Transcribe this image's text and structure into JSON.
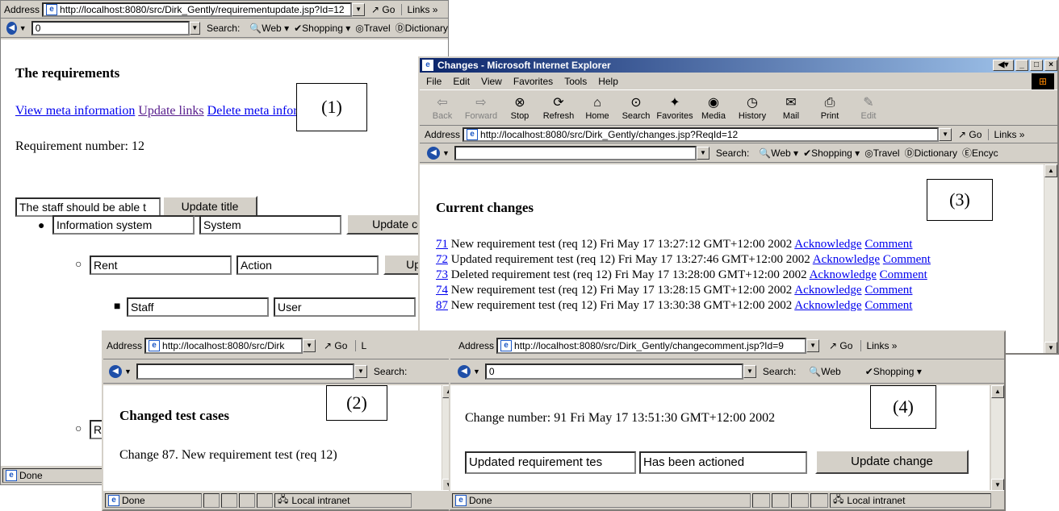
{
  "win1": {
    "address_label": "Address",
    "url": "http://localhost:8080/src/Dirk_Gently/requirementupdate.jsp?Id=12",
    "go": "Go",
    "links": "Links",
    "search_value": "0",
    "search_label": "Search:",
    "search_opts": [
      "Web",
      "Shopping",
      "Travel",
      "Dictionary"
    ],
    "heading": "The requirements",
    "link_view": "View meta information",
    "link_update": "Update links",
    "link_delete": "Delete meta information",
    "req_number": "Requirement number: 12",
    "title_value": "The staff should be able t",
    "update_title": "Update title",
    "rows": [
      {
        "a": "Information system",
        "b": "System",
        "btn": "Update co"
      },
      {
        "a": "Rent",
        "b": "Action",
        "btn": "Upd"
      },
      {
        "a": "Staff",
        "b": "User"
      },
      {
        "a": "R"
      }
    ],
    "status": "Done",
    "callout": "(1)"
  },
  "win3": {
    "title": "Changes - Microsoft Internet Explorer",
    "menu": [
      "File",
      "Edit",
      "View",
      "Favorites",
      "Tools",
      "Help"
    ],
    "tools": [
      "Back",
      "Forward",
      "Stop",
      "Refresh",
      "Home",
      "Search",
      "Favorites",
      "Media",
      "History",
      "Mail",
      "Print",
      "Edit"
    ],
    "address_label": "Address",
    "url": "http://localhost:8080/src/Dirk_Gently/changes.jsp?ReqId=12",
    "go": "Go",
    "links": "Links",
    "search_label": "Search:",
    "search_opts": [
      "Web",
      "Shopping",
      "Travel",
      "Dictionary",
      "Encyc"
    ],
    "heading": "Current changes",
    "changes": [
      {
        "id": "71",
        "text": "New requirement test (req 12) Fri May 17 13:27:12 GMT+12:00 2002"
      },
      {
        "id": "72",
        "text": "Updated requirement test (req 12) Fri May 17 13:27:46 GMT+12:00 2002"
      },
      {
        "id": "73",
        "text": "Deleted requirement test (req 12) Fri May 17 13:28:00 GMT+12:00 2002"
      },
      {
        "id": "74",
        "text": "New requirement test (req 12) Fri May 17 13:28:15 GMT+12:00 2002"
      },
      {
        "id": "87",
        "text": "New requirement test (req 12) Fri May 17 13:30:38 GMT+12:00 2002"
      }
    ],
    "ack": "Acknowledge",
    "comment": "Comment",
    "callout": "(3)"
  },
  "win2": {
    "address_label": "Address",
    "url": "http://localhost:8080/src/Dirk",
    "go": "Go",
    "links": "L",
    "search_label": "Search:",
    "heading": "Changed test cases",
    "change": "Change 87. New requirement test (req 12)",
    "status": "Done",
    "zone": "Local intranet",
    "callout": "(2)"
  },
  "win4": {
    "address_label": "Address",
    "url": "http://localhost:8080/src/Dirk_Gently/changecomment.jsp?Id=9",
    "go": "Go",
    "links": "Links",
    "search_value": "0",
    "search_label": "Search:",
    "search_opts": [
      "Web",
      "Shopping"
    ],
    "change_info": "Change number: 91 Fri May 17 13:51:30 GMT+12:00 2002",
    "field1": "Updated requirement tes",
    "field2": "Has been actioned",
    "update_btn": "Update change",
    "status": "Done",
    "zone": "Local intranet",
    "callout": "(4)"
  }
}
